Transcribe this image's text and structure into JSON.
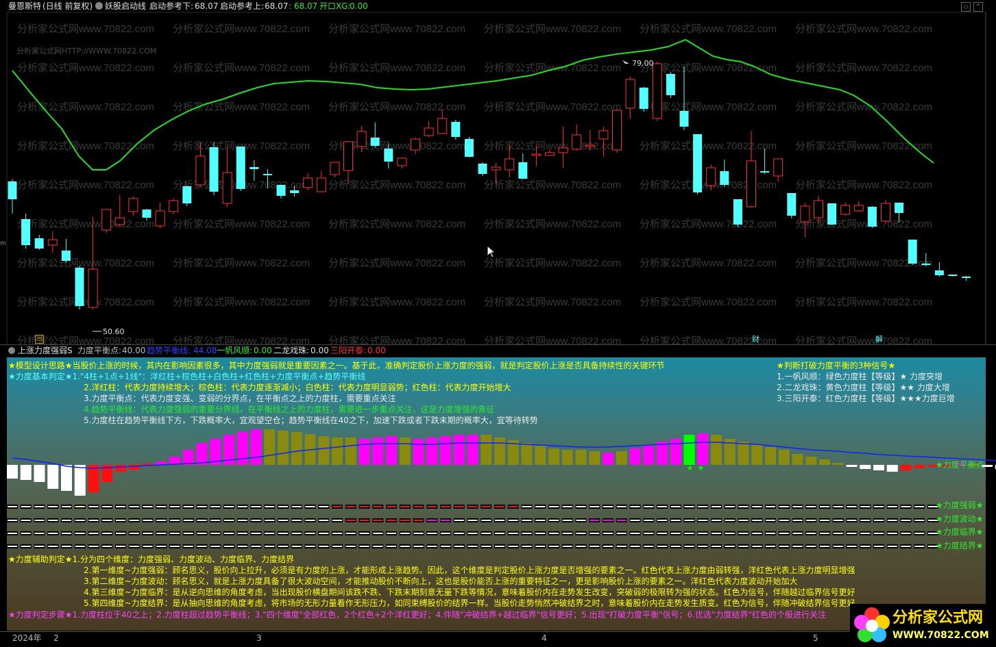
{
  "colors": {
    "up": "#ff3030",
    "down": "#54ffff",
    "ma": "#20e020",
    "bg": "#000000",
    "magenta": "#ff00ff",
    "olive": "#8a8a10",
    "blue": "#1020ff",
    "white": "#ffffff",
    "red": "#ff1010",
    "green": "#00ff00",
    "yellow": "#ffff00"
  },
  "header": {
    "stock": "曼恩斯特",
    "mode": "(日线 前复权)",
    "indicator": "妖股启动线",
    "lower_label": "启动参考下:",
    "lower_val": "68.07",
    "upper_label": "启动参考上:",
    "upper_val": "68.07",
    "extra_val": ": 68.07",
    "kai_label": "开口XG:",
    "kai_val": "0.00"
  },
  "watermark": {
    "text": "分析家公式网www.70822.com",
    "small": "分析家公式网HTTP://WWW.70822.COM"
  },
  "main": {
    "high_label": "79.00",
    "low_label": "50.60",
    "left_m": "m",
    "marker_1": "回",
    "marker_2": "财",
    "marker_3": "解"
  },
  "sub_header": {
    "name": "上涨力度强弱S",
    "p1_label": "力度平衡点:",
    "p1_val": "40.00",
    "p2_label": "趋势平衡线:",
    "p2_val": "44.08",
    "p3_label": "一帆风顺:",
    "p3_val": "0.00",
    "p4_label": "二龙戏珠:",
    "p4_val": "0.00",
    "p5_label": "三阳开泰:",
    "p5_val": "0.00"
  },
  "notes": {
    "l1": "★模型设计思路★当股价上涨的时候，其内在影响因素很多，其中力度强弱就是重要因素之一。基于此，准确判定股价上涨力度的强弱，就是判定股价上涨是否具备持续性的关键环节",
    "l2": "★力度基本判定★1.\"4柱+1点+1线\"：洋红柱+棕色柱+白色柱+红色柱+力度平衡点+趋势平衡线",
    "l3": "2.洋红柱：代表力度持续增大；棕色柱：代表力度逐渐减小；白色柱：代表力度明显弱势；红色柱：代表力度开始增大",
    "l4": "3.力度平衡点：代表力度变强、变弱的分界点，在平衡点之上的力度柱，需要重点关注",
    "l5": "4.趋势平衡线：代表力度强弱的重要分界线，在平衡线之上的力度柱，需要进一步重点关注，这是力度增强的象征",
    "l6": "5.力度柱在趋势平衡线下方，下跌概率大，宜观望空仓；趋势平衡线在40之下，加速下跌或者下跌末期的概率大，宜等待转势",
    "r1": "★判断打破力度平衡的3种信号★",
    "r2": "1.一帆风顺：绿色力度柱【等级】★    力度突增",
    "r3": "2.二龙戏珠：黄色力度柱【等级】★★  力度大增",
    "r4": "3.三阳开泰：红色力度柱【等级】★★★力度巨增",
    "b1": "★力度辅助判定★1.分为四个维度：力度强弱、力度波动、力度临界、力度结界",
    "b2": "2.第一维度~力度强弱：顾名思义，股价向上拉升，必须是有力度的上涨，才能形成上涨趋势。因此，这个维度是判定股价上涨力度是否增强的要素之一。红色代表上涨力度由弱转强，洋红色代表上涨力度明显增强",
    "b3": "3.第二维度~力度波动：顾名思义，就是上涨力度具备了很大波动空间，才能推动股价不断向上，这也是股价能否上涨的重要特征之一，更是影响股价上涨的要素之一。洋红色代表力度波动开始加大",
    "b4": "4.第三维度~力度临界：是从逆向思维的角度考虑，当出现股价横盘期间该跌不跌、下跌末期刻意无量下跌等情况，意味着股价内在走势发生改变，突破弱的极限转为强的状态。红色为信号，伴随越过临界信号更好",
    "b5": "5.第四维度~力度结界：是从抽向思维的角度考虑，将市场的无形力量看作无形压力，如同束缚股价的结界一样。当股价走势悄然冲破结界之时，意味着股价内在走势发生质变。红色为信号，伴随冲破结界信号更好",
    "b6": "★力度判定步骤★1.力度柱位于40之上；2.力度柱超过趋势平衡线；3.\"四个维度\"全部红色，2个红色+2个洋红更好；4.伴随\"冲破结界+越过临界\"信号更好；5.出现\"打破力度平衡\"信号；6.优选\"力度结界\"红色的个股进行关注"
  },
  "right_labels": {
    "balance": "★力度平衡点",
    "strength": "★力度强弱★",
    "wave": "★力度波动★",
    "critical": "★力度临界★",
    "boundary": "★力度结界★"
  },
  "xaxis": {
    "year": "2024年",
    "m2": "2",
    "m3": "3",
    "m4": "4",
    "m5": "5"
  },
  "logo": {
    "text": "分析家公式网",
    "url": "WWW.70822.COM"
  },
  "candles": [
    [
      291,
      265,
      312,
      262,
      0
    ],
    [
      358,
      320,
      363,
      312,
      0
    ],
    [
      363,
      348,
      365,
      343,
      0
    ],
    [
      350,
      358,
      369,
      338,
      1
    ],
    [
      381,
      366,
      384,
      349,
      0
    ],
    [
      447,
      391,
      452,
      388,
      0
    ],
    [
      393,
      449,
      452,
      317,
      1
    ],
    [
      306,
      336,
      340,
      312,
      1
    ],
    [
      318,
      328,
      331,
      285,
      1
    ],
    [
      290,
      309,
      315,
      287,
      1
    ],
    [
      318,
      306,
      322,
      305,
      0
    ],
    [
      308,
      330,
      333,
      296,
      1
    ],
    [
      293,
      309,
      313,
      290,
      1
    ],
    [
      297,
      272,
      301,
      271,
      0
    ],
    [
      270,
      228,
      273,
      208,
      1
    ],
    [
      215,
      280,
      285,
      207,
      0
    ],
    [
      297,
      252,
      302,
      215,
      1
    ],
    [
      276,
      214,
      279,
      214,
      0
    ],
    [
      247,
      244,
      264,
      234,
      0
    ],
    [
      256,
      254,
      275,
      247,
      0
    ],
    [
      286,
      270,
      290,
      270,
      0
    ],
    [
      282,
      278,
      287,
      271,
      0
    ],
    [
      260,
      274,
      278,
      253,
      1
    ],
    [
      260,
      280,
      280,
      250,
      1
    ],
    [
      237,
      255,
      259,
      237,
      1
    ],
    [
      249,
      207,
      269,
      207,
      1
    ],
    [
      214,
      192,
      222,
      184,
      1
    ],
    [
      201,
      213,
      216,
      179,
      0
    ],
    [
      236,
      217,
      246,
      210,
      0
    ],
    [
      242,
      231,
      246,
      230,
      1
    ],
    [
      219,
      203,
      225,
      201,
      1
    ],
    [
      187,
      198,
      200,
      177,
      1
    ],
    [
      195,
      173,
      196,
      159,
      1
    ],
    [
      178,
      200,
      204,
      175,
      0
    ],
    [
      229,
      203,
      230,
      200,
      0
    ],
    [
      254,
      239,
      257,
      237,
      0
    ],
    [
      244,
      248,
      268,
      238,
      1
    ],
    [
      232,
      248,
      259,
      212,
      1
    ],
    [
      261,
      237,
      262,
      224,
      0
    ],
    [
      225,
      226,
      243,
      212,
      1
    ],
    [
      227,
      223,
      223,
      218,
      1
    ],
    [
      216,
      223,
      245,
      185,
      1
    ],
    [
      197,
      218,
      220,
      182,
      1
    ],
    [
      212,
      212,
      220,
      190,
      1
    ],
    [
      203,
      191,
      229,
      185,
      1
    ],
    [
      219,
      161,
      223,
      160,
      1
    ],
    [
      116,
      158,
      173,
      112,
      1
    ],
    [
      128,
      159,
      163,
      127,
      0
    ],
    [
      173,
      93,
      177,
      90,
      1
    ],
    [
      108,
      139,
      143,
      105,
      0
    ],
    [
      162,
      185,
      190,
      97,
      0
    ],
    [
      196,
      281,
      284,
      196,
      0
    ],
    [
      245,
      271,
      278,
      240,
      1
    ],
    [
      250,
      270,
      273,
      233,
      0
    ],
    [
      291,
      328,
      332,
      291,
      0
    ],
    [
      235,
      302,
      303,
      191,
      1
    ],
    [
      251,
      250,
      254,
      217,
      0
    ],
    [
      257,
      232,
      265,
      232,
      1
    ],
    [
      282,
      315,
      319,
      282,
      0
    ],
    [
      324,
      301,
      346,
      296,
      1
    ],
    [
      293,
      318,
      326,
      286,
      1
    ],
    [
      297,
      328,
      329,
      297,
      0
    ],
    [
      313,
      300,
      315,
      296,
      1
    ],
    [
      300,
      308,
      309,
      294,
      1
    ],
    [
      302,
      331,
      333,
      301,
      0
    ],
    [
      323,
      297,
      326,
      292,
      1
    ],
    [
      296,
      311,
      325,
      297,
      0
    ],
    [
      350,
      385,
      387,
      350,
      0
    ],
    [
      385,
      387,
      389,
      370,
      0
    ],
    [
      395,
      402,
      404,
      383,
      0
    ],
    [
      401,
      403,
      404,
      401,
      0
    ],
    [
      404,
      405,
      410,
      403,
      0
    ]
  ],
  "ma_curve": [
    [
      18,
      103
    ],
    [
      40,
      130
    ],
    [
      65,
      160
    ],
    [
      90,
      188
    ],
    [
      115,
      228
    ],
    [
      135,
      248
    ],
    [
      155,
      248
    ],
    [
      175,
      235
    ],
    [
      200,
      210
    ],
    [
      225,
      190
    ],
    [
      250,
      175
    ],
    [
      275,
      162
    ],
    [
      300,
      152
    ],
    [
      325,
      145
    ],
    [
      350,
      136
    ],
    [
      375,
      128
    ],
    [
      400,
      122
    ],
    [
      425,
      120
    ],
    [
      450,
      118
    ],
    [
      475,
      119
    ],
    [
      500,
      121
    ],
    [
      525,
      123
    ],
    [
      550,
      128
    ],
    [
      575,
      130
    ],
    [
      600,
      131
    ],
    [
      625,
      130
    ],
    [
      650,
      127
    ],
    [
      675,
      124
    ],
    [
      700,
      121
    ],
    [
      725,
      118
    ],
    [
      750,
      114
    ],
    [
      775,
      110
    ],
    [
      800,
      103
    ],
    [
      825,
      97
    ],
    [
      850,
      88
    ],
    [
      875,
      83
    ],
    [
      900,
      79
    ],
    [
      925,
      76
    ],
    [
      950,
      73
    ],
    [
      975,
      68
    ],
    [
      1000,
      58
    ],
    [
      1020,
      70
    ],
    [
      1040,
      82
    ],
    [
      1060,
      87
    ],
    [
      1080,
      90
    ],
    [
      1100,
      97
    ],
    [
      1125,
      109
    ],
    [
      1150,
      116
    ],
    [
      1175,
      121
    ],
    [
      1200,
      126
    ],
    [
      1225,
      131
    ],
    [
      1245,
      139
    ],
    [
      1270,
      155
    ],
    [
      1295,
      178
    ],
    [
      1320,
      203
    ],
    [
      1345,
      225
    ],
    [
      1362,
      238
    ]
  ],
  "strength_bars": [
    [
      -20,
      "w"
    ],
    [
      -22,
      "w"
    ],
    [
      -25,
      "w"
    ],
    [
      -35,
      "w"
    ],
    [
      -38,
      "w"
    ],
    [
      -45,
      "w"
    ],
    [
      -40,
      "r"
    ],
    [
      -25,
      "r"
    ],
    [
      -10,
      "r"
    ],
    [
      -7,
      "r"
    ],
    [
      2,
      "r"
    ],
    [
      5,
      "m"
    ],
    [
      12,
      "m"
    ],
    [
      22,
      "m"
    ],
    [
      32,
      "m"
    ],
    [
      38,
      "m"
    ],
    [
      44,
      "m"
    ],
    [
      48,
      "m"
    ],
    [
      52,
      "m"
    ],
    [
      52,
      "o"
    ],
    [
      50,
      "o"
    ],
    [
      48,
      "o"
    ],
    [
      45,
      "o"
    ],
    [
      42,
      "o"
    ],
    [
      40,
      "o"
    ],
    [
      40,
      "o"
    ],
    [
      38,
      "m"
    ],
    [
      40,
      "m"
    ],
    [
      42,
      "m"
    ],
    [
      40,
      "o"
    ],
    [
      38,
      "m"
    ],
    [
      40,
      "m"
    ],
    [
      42,
      "m"
    ],
    [
      44,
      "m"
    ],
    [
      44,
      "m"
    ],
    [
      44,
      "o"
    ],
    [
      40,
      "o"
    ],
    [
      36,
      "o"
    ],
    [
      32,
      "o"
    ],
    [
      28,
      "o"
    ],
    [
      24,
      "o"
    ],
    [
      22,
      "o"
    ],
    [
      22,
      "o"
    ],
    [
      20,
      "o"
    ],
    [
      18,
      "m"
    ],
    [
      20,
      "o"
    ],
    [
      24,
      "m"
    ],
    [
      28,
      "m"
    ],
    [
      34,
      "m"
    ],
    [
      38,
      "m"
    ],
    [
      44,
      "g"
    ],
    [
      46,
      "m"
    ],
    [
      44,
      "o"
    ],
    [
      38,
      "o"
    ],
    [
      34,
      "o"
    ],
    [
      30,
      "o"
    ],
    [
      26,
      "o"
    ],
    [
      22,
      "o"
    ],
    [
      16,
      "o"
    ],
    [
      12,
      "o"
    ],
    [
      8,
      "o"
    ],
    [
      3,
      "o"
    ],
    [
      -3,
      "w"
    ],
    [
      -6,
      "w"
    ],
    [
      -8,
      "w"
    ],
    [
      -10,
      "w"
    ],
    [
      -8,
      "r"
    ],
    [
      -5,
      "r"
    ],
    [
      -3,
      "r"
    ],
    [
      -2,
      "r"
    ],
    [
      2,
      "m"
    ],
    [
      1,
      "o"
    ],
    [
      -3,
      "w"
    ],
    [
      -6,
      "w"
    ],
    [
      -10,
      "w"
    ],
    [
      -12,
      "w"
    ]
  ]
}
